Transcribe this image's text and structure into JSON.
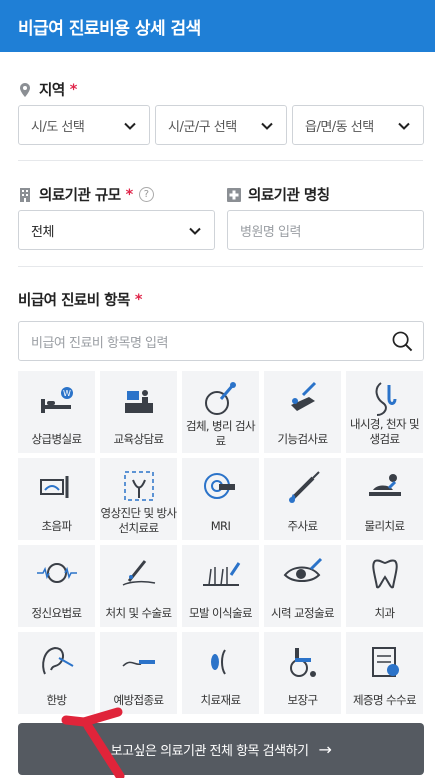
{
  "header": {
    "title": "비급여 진료비용 상세 검색"
  },
  "region": {
    "label": "지역",
    "required_mark": "*",
    "selects": [
      "시/도 선택",
      "시/군/구 선택",
      "읍/면/동 선택"
    ]
  },
  "facility_size": {
    "label": "의료기관 규모",
    "required_mark": "*",
    "help": "?",
    "value": "전체"
  },
  "facility_name": {
    "label": "의료기관 명칭",
    "placeholder": "병원명 입력"
  },
  "items": {
    "label": "비급여 진료비 항목",
    "required_mark": "*",
    "search_placeholder": "비급여 진료비 항목명 입력",
    "categories": [
      {
        "label": "상급병실료",
        "icon": "hospital-bed-icon"
      },
      {
        "label": "교육상담료",
        "icon": "consultation-desk-icon"
      },
      {
        "label": "검체, 병리 검사료",
        "icon": "specimen-test-icon"
      },
      {
        "label": "기능검사료",
        "icon": "function-test-icon"
      },
      {
        "label": "내시경, 천자 및 생검료",
        "icon": "endoscope-icon"
      },
      {
        "label": "초음파",
        "icon": "ultrasound-icon"
      },
      {
        "label": "영상진단 및 방사선치료료",
        "icon": "imaging-diagnosis-icon"
      },
      {
        "label": "MRI",
        "icon": "mri-icon"
      },
      {
        "label": "주사료",
        "icon": "syringe-icon"
      },
      {
        "label": "물리치료",
        "icon": "physical-therapy-icon"
      },
      {
        "label": "정신요법료",
        "icon": "brain-icon"
      },
      {
        "label": "처치 및 수술료",
        "icon": "surgery-icon"
      },
      {
        "label": "모발 이식술료",
        "icon": "hair-transplant-icon"
      },
      {
        "label": "시력 교정술료",
        "icon": "eye-icon"
      },
      {
        "label": "치과",
        "icon": "tooth-icon"
      },
      {
        "label": "한방",
        "icon": "acupuncture-icon"
      },
      {
        "label": "예방접종료",
        "icon": "vaccination-icon"
      },
      {
        "label": "치료재료",
        "icon": "treatment-material-icon"
      },
      {
        "label": "보장구",
        "icon": "wheelchair-icon"
      },
      {
        "label": "제증명 수수료",
        "icon": "certificate-icon"
      }
    ]
  },
  "bottom_button": {
    "label": "보고싶은 의료기관 전체 항목 검색하기",
    "arrow": "→"
  },
  "colors": {
    "header": "#1f7fd6",
    "required": "#e0254a",
    "button": "#555a61",
    "annotation_arrow": "#e0243a"
  }
}
